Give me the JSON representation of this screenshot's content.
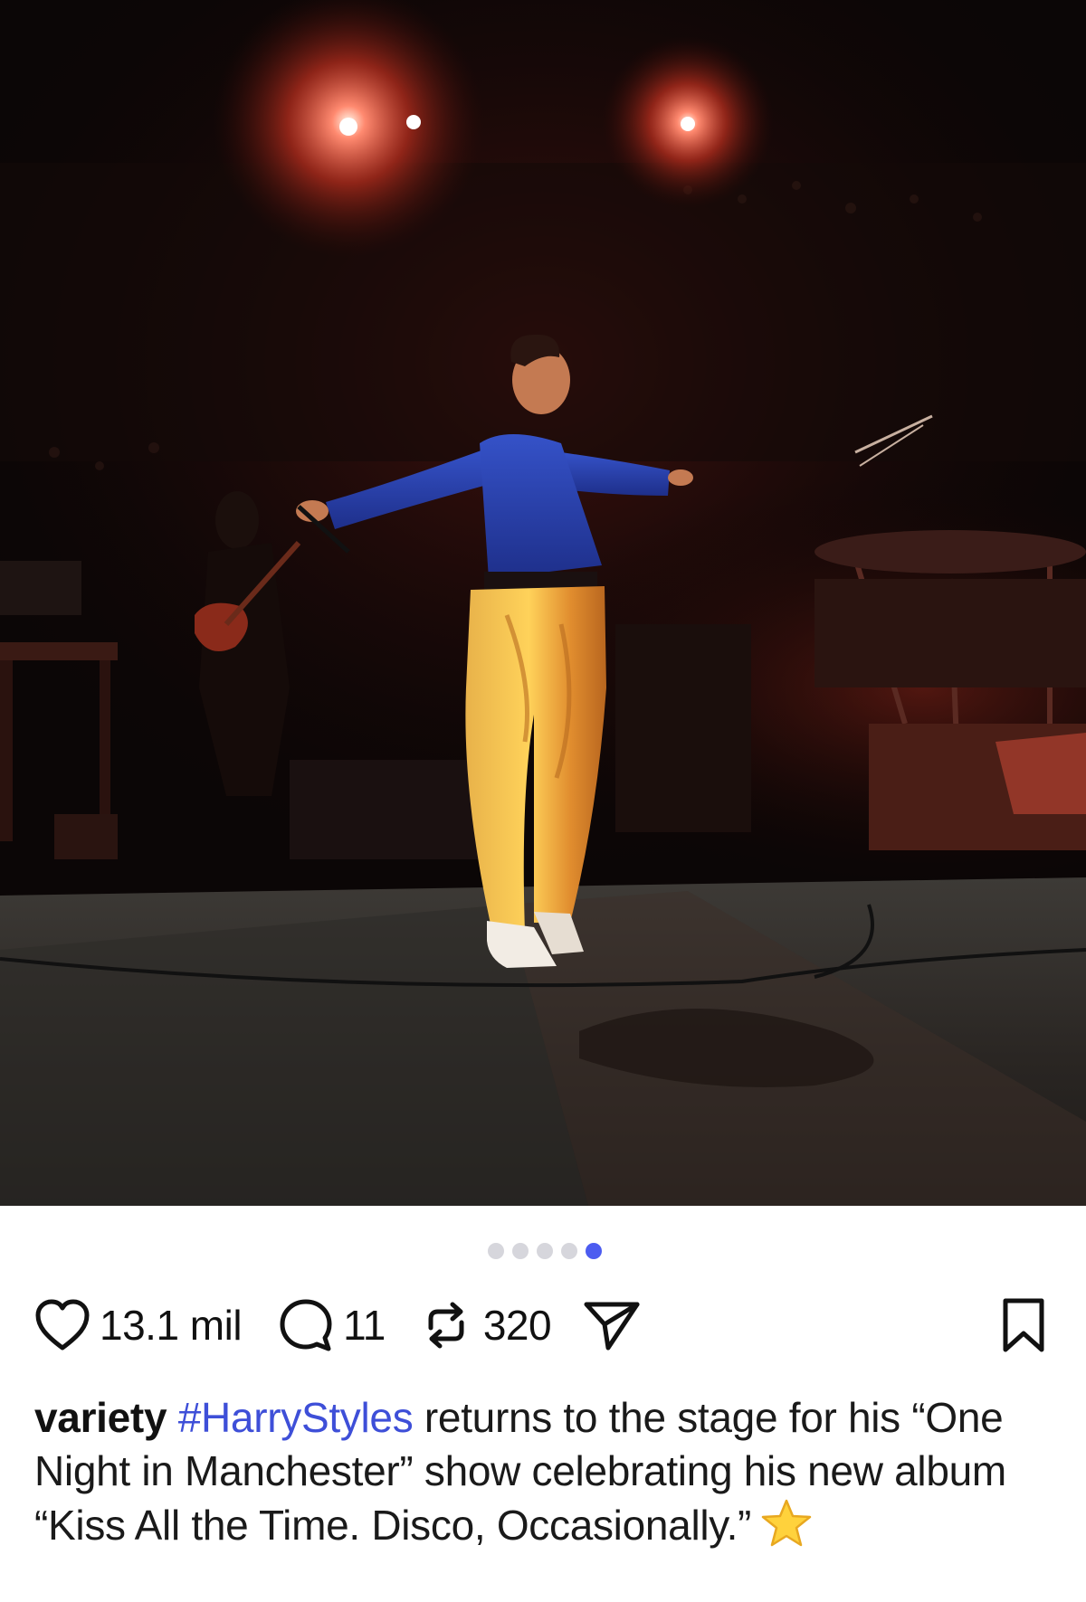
{
  "post": {
    "image_description_icon": "concert-photo",
    "carousel": {
      "total": 5,
      "active_index": 4
    },
    "likes": "13.1 mil",
    "comments": "11",
    "reposts": "320",
    "caption": {
      "username": "variety",
      "hashtag": "#HarryStyles",
      "text": " returns to the stage for his “One Night in Manchester” show celebrating his new album “Kiss All the Time. Disco, Occasionally.”",
      "emoji": "star-emoji"
    }
  },
  "colors": {
    "accent": "#4c5cf0",
    "hashtag": "#3e4fd8",
    "star_fill": "#ffd23c"
  },
  "icons": [
    "heart-icon",
    "comment-icon",
    "repost-icon",
    "share-icon",
    "bookmark-icon"
  ]
}
